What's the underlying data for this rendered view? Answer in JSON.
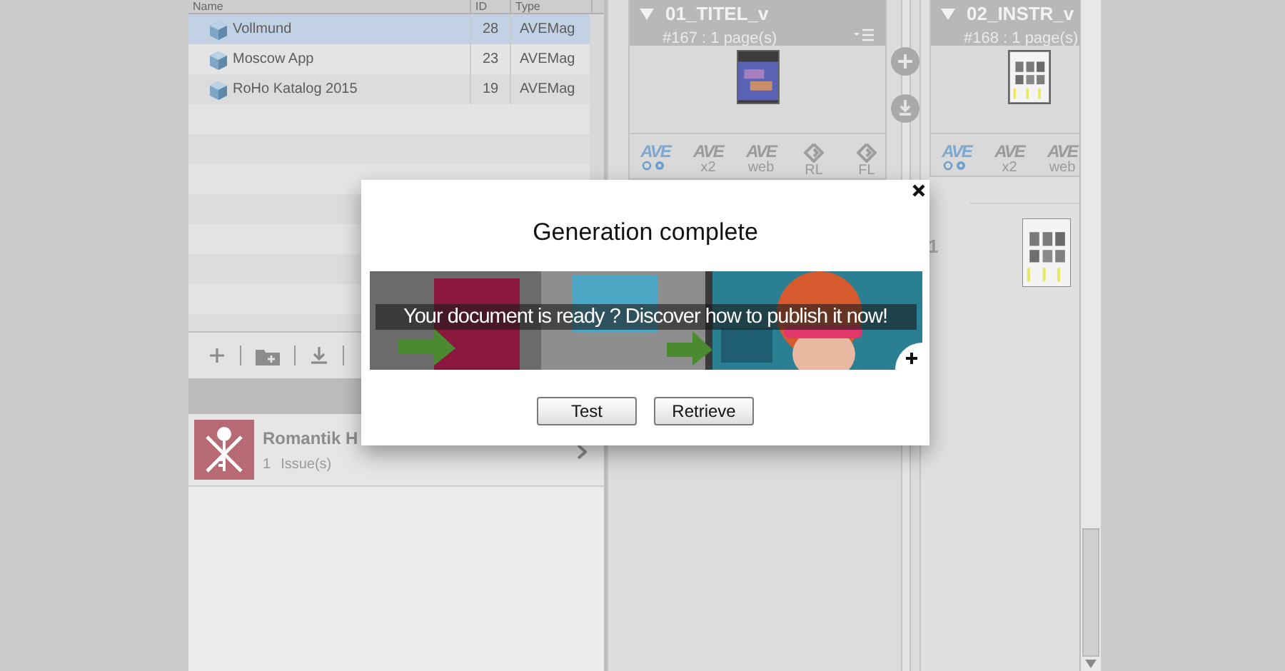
{
  "library": {
    "columns": [
      "Name",
      "ID",
      "Type"
    ],
    "rows": [
      {
        "name": "Vollmund",
        "id": "28",
        "type": "AVEMag",
        "selected": true
      },
      {
        "name": "Moscow App",
        "id": "23",
        "type": "AVEMag",
        "selected": false
      },
      {
        "name": "RoHo Katalog 2015",
        "id": "19",
        "type": "AVEMag",
        "selected": false
      }
    ]
  },
  "publications": [
    {
      "title": "Romantik H",
      "count": "1",
      "label": "Issue(s)"
    }
  ],
  "sections": [
    {
      "title": "01_TITEL_v",
      "info": "#167 : 1 page(s)",
      "expanded": true,
      "formats": [
        {
          "kind": "settings",
          "logo": "AVE"
        },
        {
          "kind": "ave",
          "logo": "AVE",
          "caption": "x2"
        },
        {
          "kind": "ave",
          "logo": "AVE",
          "caption": "web"
        },
        {
          "kind": "epub",
          "caption": "RL"
        },
        {
          "kind": "epub",
          "caption": "FL"
        }
      ]
    },
    {
      "title": "02_INSTR_v",
      "info": "#168 : 1 page(s)",
      "expanded": true,
      "formats": [
        {
          "kind": "settings",
          "logo": "AVE"
        },
        {
          "kind": "ave",
          "logo": "AVE",
          "caption": "x2"
        },
        {
          "kind": "ave",
          "logo": "AVE",
          "caption": "web"
        }
      ]
    }
  ],
  "pages": [
    {
      "number": "1"
    }
  ],
  "dialog": {
    "title": "Generation complete",
    "banner_text": "Your document is ready ? Discover how to publish it now!",
    "buttons": [
      "Test",
      "Retrieve"
    ]
  }
}
